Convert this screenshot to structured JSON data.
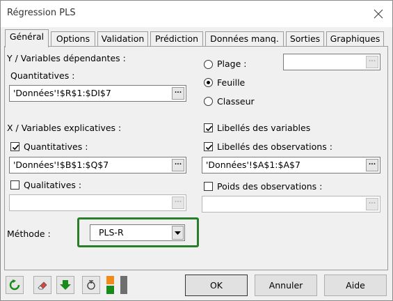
{
  "window": {
    "title": "Régression PLS",
    "close_glyph": "✕"
  },
  "tabs": [
    {
      "label": "Général",
      "active": true
    },
    {
      "label": "Options"
    },
    {
      "label": "Validation"
    },
    {
      "label": "Prédiction"
    },
    {
      "label": "Données manq."
    },
    {
      "label": "Sorties"
    },
    {
      "label": "Graphiques"
    }
  ],
  "y_section": {
    "heading": "Y / Variables dépendantes :",
    "quantitatives_label": "Quantitatives :",
    "quantitatives_value": "'Données'!$R$1:$DI$7"
  },
  "x_section": {
    "heading": "X / Variables explicatives :",
    "quantitatives_label": "Quantitatives :",
    "quantitatives_checked": true,
    "quantitatives_value": "'Données'!$B$1:$Q$7",
    "qualitatives_label": "Qualitatives :",
    "qualitatives_checked": false,
    "qualitatives_value": ""
  },
  "output_target": {
    "options": [
      "Plage :",
      "Feuille",
      "Classeur"
    ],
    "selected": "Feuille",
    "range_value": ""
  },
  "options": {
    "variable_labels": "Libellés des variables",
    "variable_labels_checked": true,
    "observation_labels": "Libellés des observations :",
    "observation_labels_checked": true,
    "observation_labels_value": "'Données'!$A$1:$A$7",
    "observation_weights": "Poids des observations :",
    "observation_weights_checked": false,
    "observation_weights_value": ""
  },
  "method": {
    "label": "Méthode :",
    "value": "PLS-R"
  },
  "buttons": {
    "ok": "OK",
    "cancel": "Annuler",
    "help": "Aide"
  },
  "dot_button_glyph": "...",
  "colors": {
    "accent_green": "#2a7d2a"
  },
  "toolbar_icons": [
    "reset-icon",
    "eraser-icon",
    "down-arrow-icon",
    "save-icon",
    "layout-icon"
  ]
}
